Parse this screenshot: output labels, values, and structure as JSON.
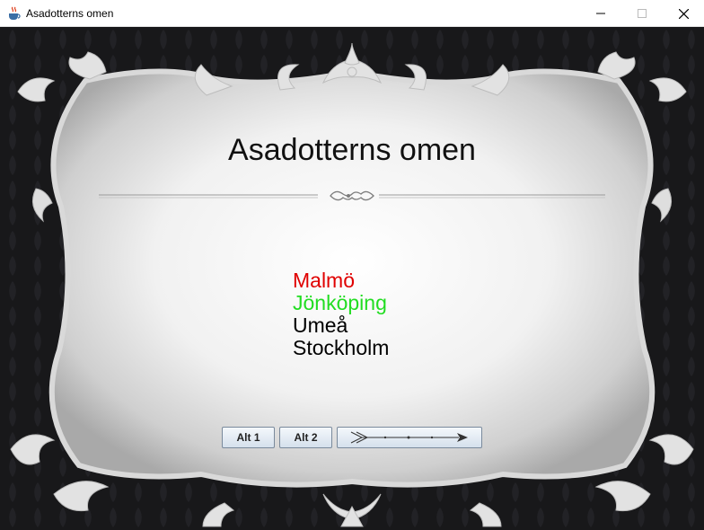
{
  "window": {
    "title": "Asadotterns omen",
    "app_icon": "java-coffee-cup-icon",
    "controls": [
      "minimize-icon",
      "maximize-icon",
      "close-icon"
    ]
  },
  "slide": {
    "heading": "Asadotterns omen",
    "options": [
      {
        "label": "Malmö",
        "color": "#e00000"
      },
      {
        "label": "Jönköping",
        "color": "#22dd22"
      },
      {
        "label": "Umeå",
        "color": "#000000"
      },
      {
        "label": "Stockholm",
        "color": "#000000"
      }
    ]
  },
  "controls": {
    "alt1_label": "Alt 1",
    "alt2_label": "Alt 2",
    "arrow_button_icon": "arrow-icon"
  },
  "colors": {
    "frame_dark": "#1a1a1c",
    "panel_light": "#f4f4f4"
  }
}
